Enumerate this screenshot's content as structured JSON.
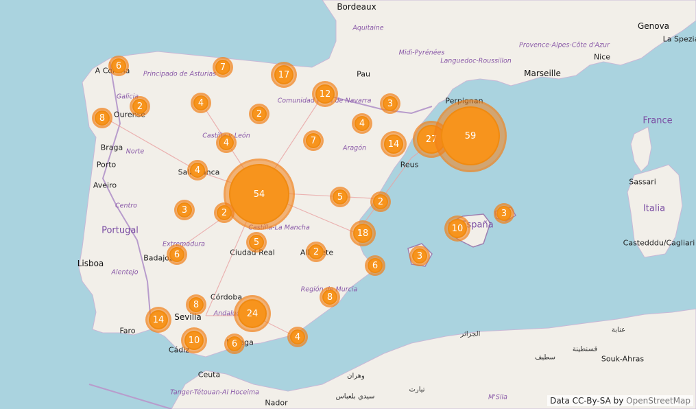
{
  "map": {
    "clusters": [
      {
        "count": "6",
        "size": "small"
      },
      {
        "count": "7",
        "size": "small"
      },
      {
        "count": "17",
        "size": "medium"
      },
      {
        "count": "12",
        "size": "medium"
      },
      {
        "count": "2",
        "size": "small"
      },
      {
        "count": "4",
        "size": "small"
      },
      {
        "count": "8",
        "size": "small"
      },
      {
        "count": "2",
        "size": "small"
      },
      {
        "count": "3",
        "size": "small"
      },
      {
        "count": "4",
        "size": "small"
      },
      {
        "count": "7",
        "size": "small"
      },
      {
        "count": "4",
        "size": "small"
      },
      {
        "count": "14",
        "size": "medium"
      },
      {
        "count": "27",
        "size": "large"
      },
      {
        "count": "59",
        "size": "xlarge"
      },
      {
        "count": "4",
        "size": "small"
      },
      {
        "count": "54",
        "size": "xlarge"
      },
      {
        "count": "5",
        "size": "small"
      },
      {
        "count": "2",
        "size": "small"
      },
      {
        "count": "3",
        "size": "small"
      },
      {
        "count": "2",
        "size": "small"
      },
      {
        "count": "18",
        "size": "medium"
      },
      {
        "count": "5",
        "size": "small"
      },
      {
        "count": "6",
        "size": "small"
      },
      {
        "count": "2",
        "size": "small"
      },
      {
        "count": "6",
        "size": "small"
      },
      {
        "count": "10",
        "size": "medium"
      },
      {
        "count": "3",
        "size": "small"
      },
      {
        "count": "3",
        "size": "small"
      },
      {
        "count": "8",
        "size": "small"
      },
      {
        "count": "8",
        "size": "small"
      },
      {
        "count": "24",
        "size": "large"
      },
      {
        "count": "14",
        "size": "medium"
      },
      {
        "count": "10",
        "size": "medium"
      },
      {
        "count": "6",
        "size": "small"
      },
      {
        "count": "4",
        "size": "small"
      }
    ],
    "cities": [
      "Bordeaux",
      "A Coruña",
      "Ourense",
      "Braga",
      "Porto",
      "Aveiro",
      "Lisboa",
      "Faro",
      "Sevilla",
      "Cádiz",
      "Córdoba",
      "Málaga",
      "Badajoz",
      "Salamanca",
      "Ciudad Real",
      "Albacete",
      "Pau",
      "Perpignan",
      "Reus",
      "Marseille",
      "Nice",
      "Genova",
      "La Spezia",
      "Sassari",
      "Castedddu/Cagliari",
      "Ceuta",
      "Nador",
      "Oran"
    ],
    "regions": [
      "Aquitaine",
      "Midi-Pyrénées",
      "Languedoc-Roussillon",
      "Provence-Alpes-Côte d'Azur",
      "Principado de Asturias",
      "Galicia",
      "Castilla y León",
      "Comunidad Foral de Navarra",
      "Aragón",
      "Norte",
      "Centro",
      "Extremadura",
      "Alentejo",
      "Andalucía",
      "Castilla-La Mancha",
      "Región de Murcia",
      "Tanger-Tétouan-Al Hoceima"
    ],
    "countries": [
      "France",
      "España",
      "Portugal",
      "Italia"
    ],
    "arabic_labels": [
      "الجزائر",
      "وهران",
      "عنابة",
      "قسنطينة",
      "سطيف",
      "سيدي بلعباس",
      "تيارت"
    ],
    "misc_labels": [
      "Souk-Ahras",
      "M'Sila"
    ]
  },
  "attribution": {
    "prefix": "Data CC-By-SA by",
    "link": "OpenStreetMap"
  },
  "colors": {
    "sea": "#aad3df",
    "land": "#f2efe9",
    "cluster": "#f7941d",
    "border": "#9e7fb0"
  }
}
